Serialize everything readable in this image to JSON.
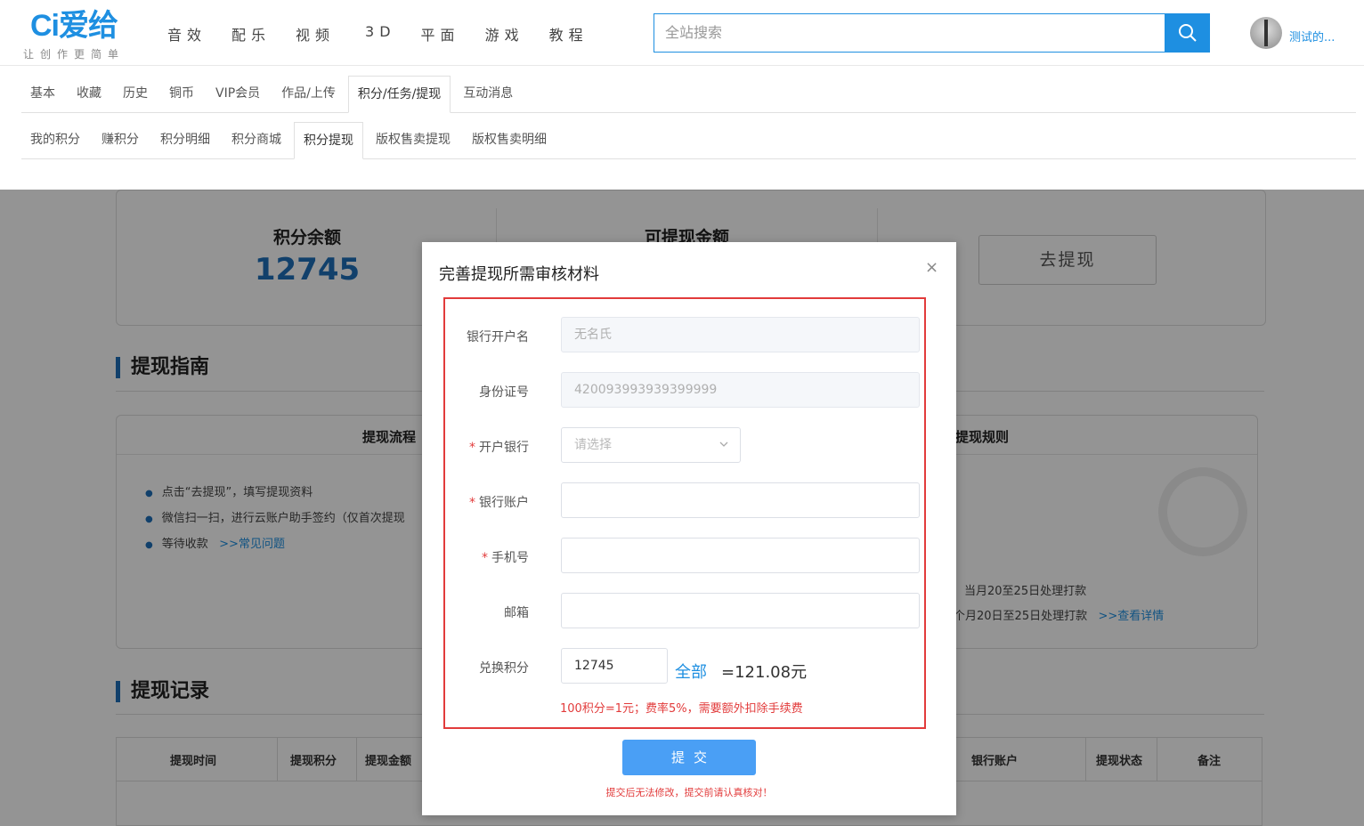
{
  "header": {
    "logo_text": "Ci爱给",
    "slogan": "让创作更简单",
    "nav": [
      "音效",
      "配乐",
      "视频",
      "3D",
      "平面",
      "游戏",
      "教程"
    ],
    "search_placeholder": "全站搜索",
    "username": "测试的..."
  },
  "tabs_primary": [
    {
      "label": "基本",
      "active": false
    },
    {
      "label": "收藏",
      "active": false
    },
    {
      "label": "历史",
      "active": false
    },
    {
      "label": "铜币",
      "active": false
    },
    {
      "label": "VIP会员",
      "active": false
    },
    {
      "label": "作品/上传",
      "active": false
    },
    {
      "label": "积分/任务/提现",
      "active": true
    },
    {
      "label": "互动消息",
      "active": false
    }
  ],
  "tabs_secondary": [
    {
      "label": "我的积分",
      "active": false
    },
    {
      "label": "赚积分",
      "active": false
    },
    {
      "label": "积分明细",
      "active": false
    },
    {
      "label": "积分商城",
      "active": false
    },
    {
      "label": "积分提现",
      "active": true
    },
    {
      "label": "版权售卖提现",
      "active": false
    },
    {
      "label": "版权售卖明细",
      "active": false
    }
  ],
  "balance": {
    "points_label": "积分余额",
    "points_value": "12745",
    "withdrawable_label": "可提现金额",
    "go_button": "去提现"
  },
  "guide": {
    "title": "提现指南",
    "process_title": "提现流程",
    "rules_title": "提现规则",
    "steps": [
      "点击“去提现”，填写提现资料",
      "微信扫一扫，进行云账户助手签约（仅首次提现",
      "等待收款"
    ],
    "faq_link": ">>常见问题",
    "rule_1": "当月20至25日处理打款",
    "rule_2": "个月20日至25日处理打款",
    "details_link": ">>查看详情"
  },
  "records": {
    "title": "提现记录",
    "columns": [
      "提现时间",
      "提现积分",
      "提现金额",
      "银行账户",
      "提现状态",
      "备注"
    ]
  },
  "modal": {
    "title": "完善提现所需审核材料",
    "close": "×",
    "fields": {
      "account_name_label": "银行开户名",
      "account_name_value": "无名氏",
      "id_label": "身份证号",
      "id_value": "420093993939399999",
      "bank_label": "开户银行",
      "bank_placeholder": "请选择",
      "account_label": "银行账户",
      "phone_label": "手机号",
      "email_label": "邮箱",
      "points_label": "兑换积分",
      "points_value": "12745",
      "all_link": "全部",
      "equals": "=121.08元"
    },
    "required_mark": "*",
    "note": "100积分=1元；费率5%，需要额外扣除手续费",
    "submit": "提交",
    "warning": "提交后无法修改，提交前请认真核对！"
  },
  "colors": {
    "accent": "#1e8fe1",
    "highlight_border": "#e23b3b",
    "submit": "#4a9ff5"
  }
}
